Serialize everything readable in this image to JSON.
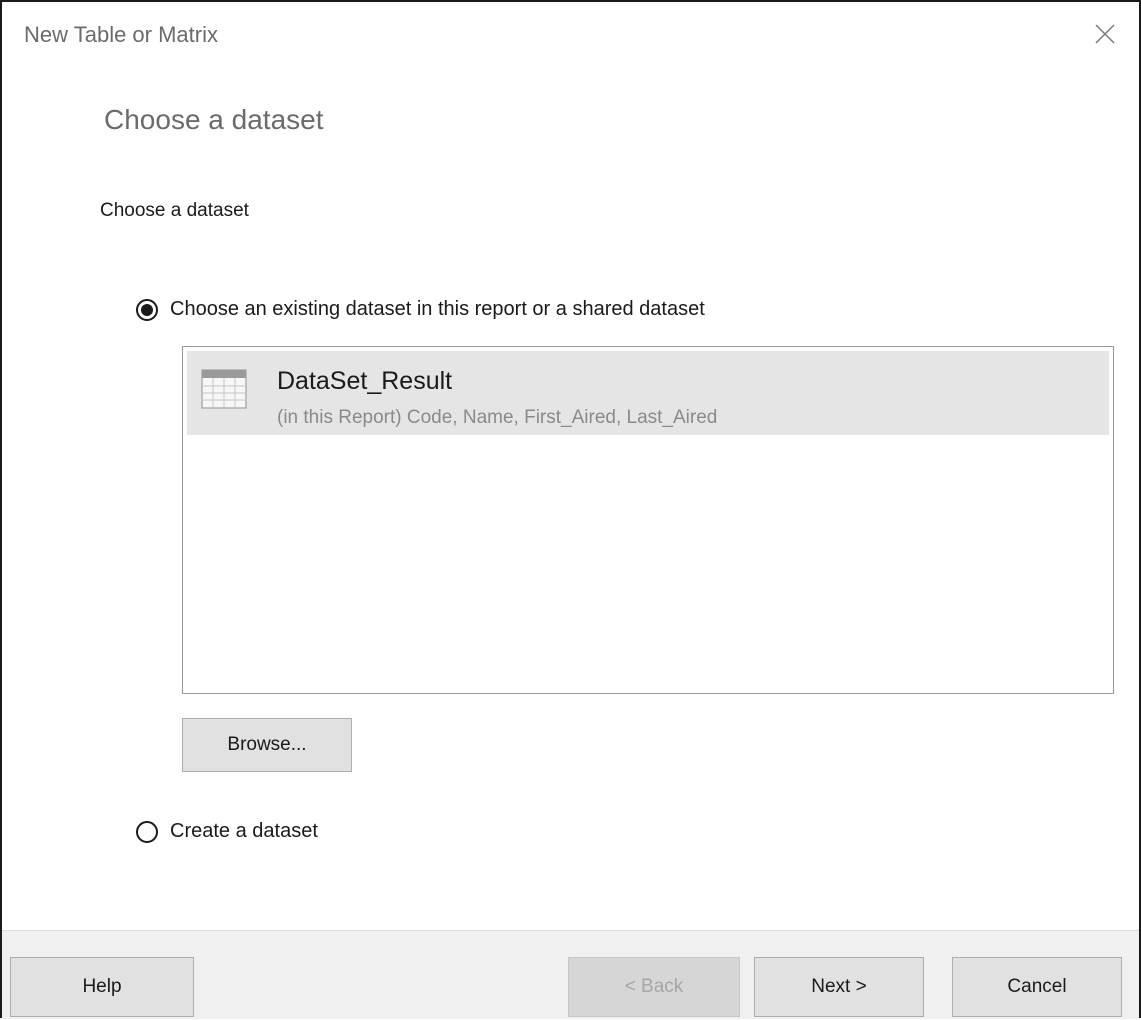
{
  "window": {
    "title": "New Table or Matrix"
  },
  "page": {
    "heading": "Choose a dataset",
    "section_label": "Choose a dataset"
  },
  "options": {
    "existing": {
      "label": "Choose an existing dataset in this report or a shared dataset",
      "selected": true
    },
    "create": {
      "label": "Create a dataset",
      "selected": false
    }
  },
  "datasets": [
    {
      "name": "DataSet_Result",
      "description": "(in this Report) Code, Name, First_Aired, Last_Aired",
      "icon": "table-icon",
      "selected": true
    }
  ],
  "buttons": {
    "browse": "Browse...",
    "help": "Help",
    "back": "< Back",
    "next": "Next >",
    "cancel": "Cancel"
  }
}
